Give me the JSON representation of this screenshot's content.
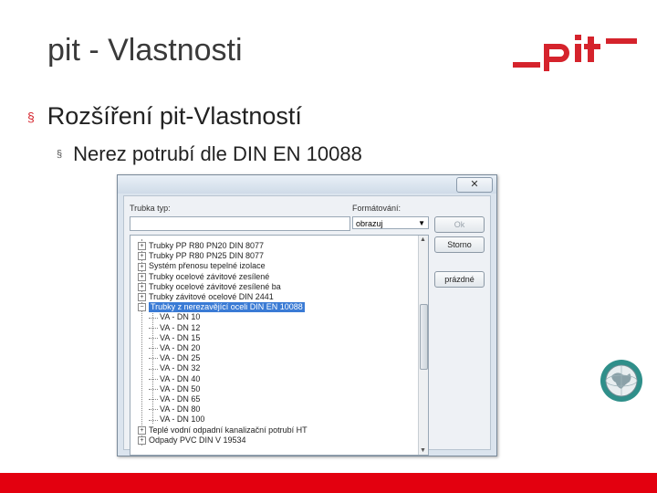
{
  "slide": {
    "title": "pit - Vlastnosti",
    "bullet1": "Rozšíření pit-Vlastností",
    "bullet2": "Nerez potrubí dle DIN EN 10088",
    "bullet_mark": "§",
    "colors": {
      "accent": "#e3000f",
      "logo": "#d5232c"
    }
  },
  "logo": {
    "text": "_pit—"
  },
  "dialog": {
    "close_label": "✕",
    "pipe_type_label": "Trubka typ:",
    "format_label": "Formátování:",
    "format_value": "obrazuj",
    "ok_label": "Ok",
    "cancel_label": "Storno",
    "empty_label": "prázdné",
    "tree": [
      {
        "label": "Trubky PP R80 PN20 DIN 8077",
        "level": 0,
        "expander": "+"
      },
      {
        "label": "Trubky PP R80 PN25 DIN 8077",
        "level": 0,
        "expander": "+"
      },
      {
        "label": "Systém přenosu tepelné izolace",
        "level": 0,
        "expander": "+"
      },
      {
        "label": "Trubky ocelové závitové zesílené",
        "level": 0,
        "expander": "+"
      },
      {
        "label": "Trubky ocelové závitové zesílené ba",
        "level": 0,
        "expander": "+"
      },
      {
        "label": "Trubky závitové ocelové DIN 2441",
        "level": 0,
        "expander": "+"
      },
      {
        "label": "Trubky z nerezavějící oceli DIN EN 10088",
        "level": 0,
        "expander": "−",
        "selected": true
      },
      {
        "label": "VA - DN 10",
        "level": 1
      },
      {
        "label": "VA - DN 12",
        "level": 1
      },
      {
        "label": "VA - DN 15",
        "level": 1
      },
      {
        "label": "VA - DN 20",
        "level": 1
      },
      {
        "label": "VA - DN 25",
        "level": 1
      },
      {
        "label": "VA - DN 32",
        "level": 1
      },
      {
        "label": "VA - DN 40",
        "level": 1
      },
      {
        "label": "VA - DN 50",
        "level": 1
      },
      {
        "label": "VA - DN 65",
        "level": 1
      },
      {
        "label": "VA - DN 80",
        "level": 1
      },
      {
        "label": "VA - DN 100",
        "level": 1
      },
      {
        "label": "Teplé vodní odpadní kanalizační potrubí HT",
        "level": 0,
        "expander": "+"
      },
      {
        "label": "Odpady PVC DIN V 19534",
        "level": 0,
        "expander": "+"
      }
    ]
  }
}
